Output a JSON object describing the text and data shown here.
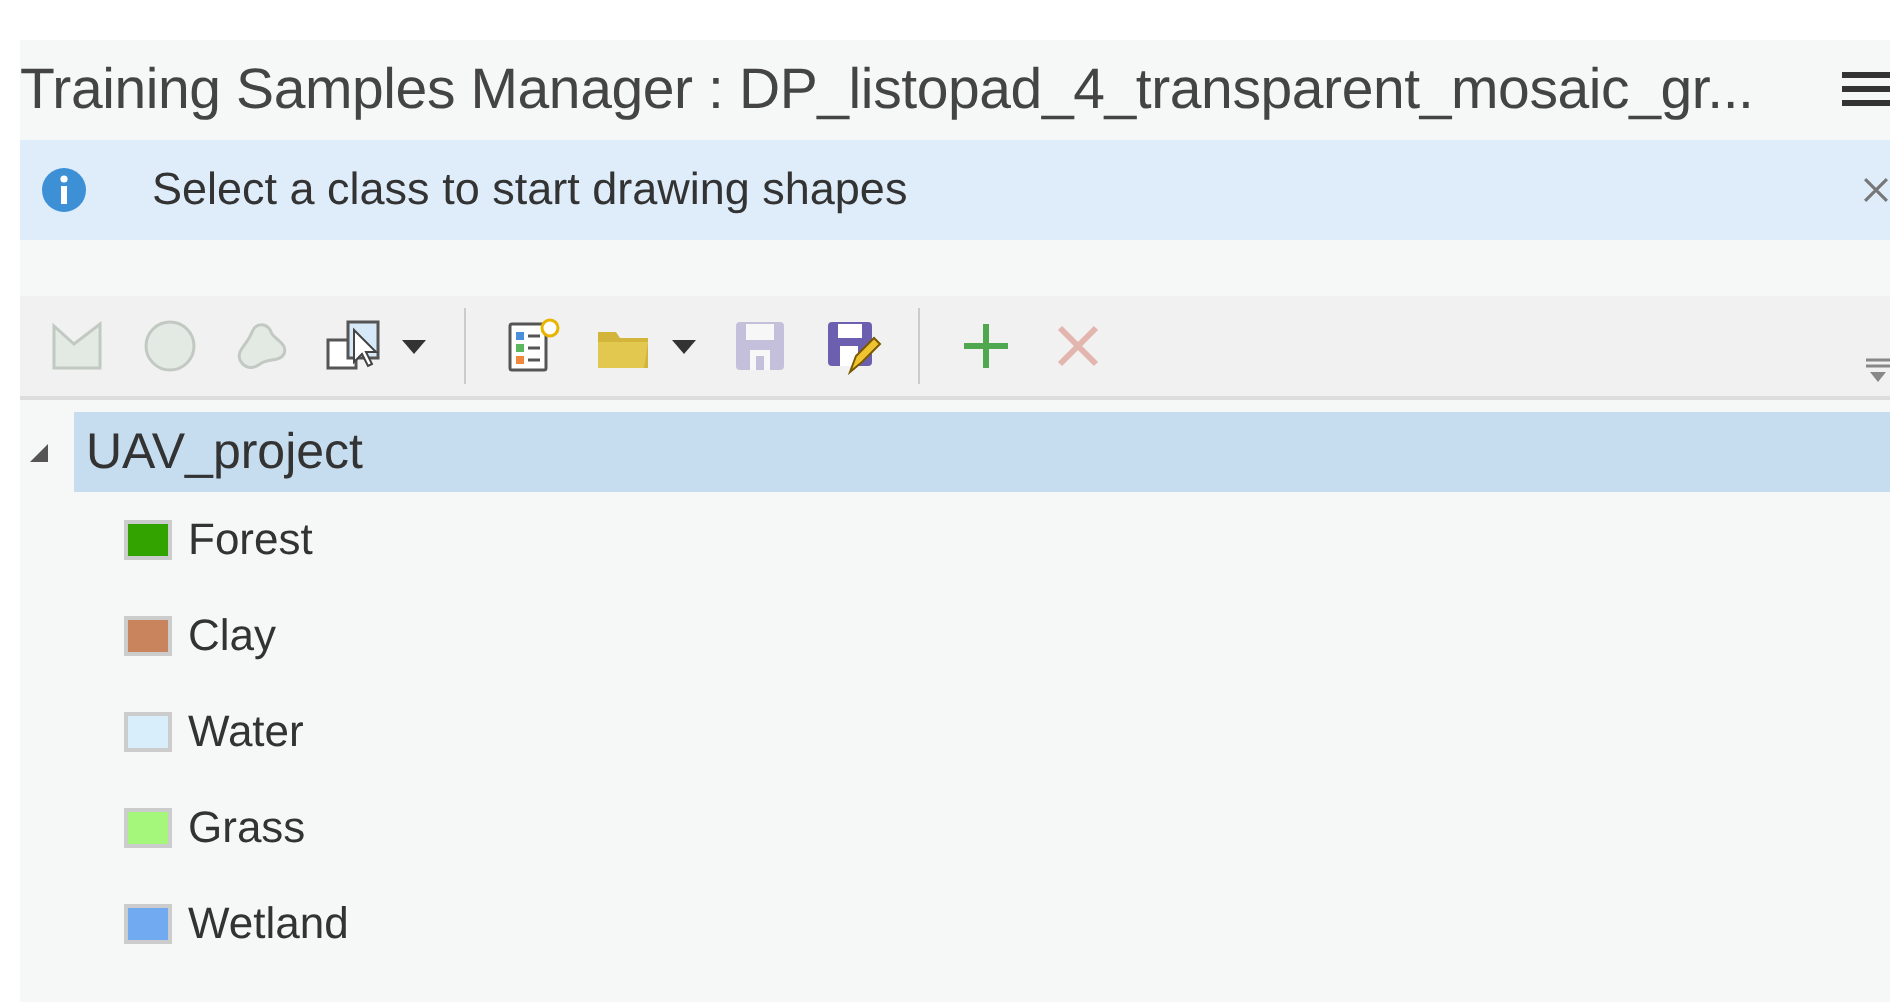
{
  "window": {
    "title": "Training Samples Manager : DP_listopad_4_transparent_mosaic_gr..."
  },
  "info_bar": {
    "message": "Select a class to start drawing shapes"
  },
  "toolbar": [
    {
      "kind": "button",
      "disabled": true
    },
    {
      "kind": "button",
      "disabled": true
    },
    {
      "kind": "button",
      "disabled": true
    },
    {
      "kind": "dropdown",
      "disabled": false
    },
    {
      "kind": "separator"
    },
    {
      "kind": "button",
      "disabled": false
    },
    {
      "kind": "dropdown",
      "disabled": false
    },
    {
      "kind": "button",
      "disabled": true
    },
    {
      "kind": "button",
      "disabled": false
    },
    {
      "kind": "separator"
    },
    {
      "kind": "button",
      "disabled": false
    },
    {
      "kind": "button",
      "disabled": true
    }
  ],
  "tree": {
    "label": "UAV_project",
    "selected": true,
    "expanded": true,
    "children": [
      {
        "label": "Forest",
        "color": "#33a300"
      },
      {
        "label": "Clay",
        "color": "#c9845e"
      },
      {
        "label": "Water",
        "color": "#d8eefa"
      },
      {
        "label": "Grass",
        "color": "#a4f77a"
      },
      {
        "label": "Wetland",
        "color": "#72aaf2"
      }
    ]
  }
}
